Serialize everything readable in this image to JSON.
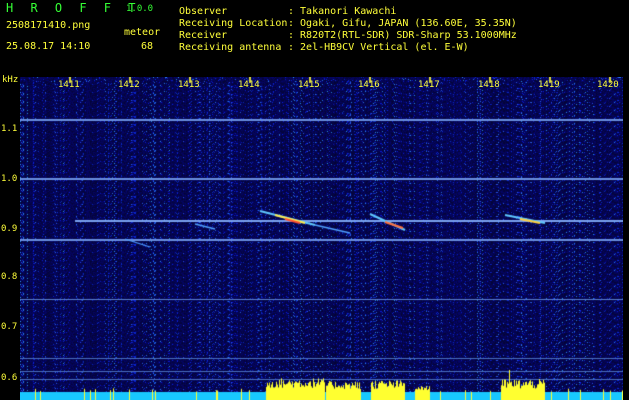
{
  "header": {
    "app_title": "H R O F F T",
    "version": "1.0.0",
    "filename": "2508171410.png",
    "datetime": "25.08.17 14:10",
    "meteor_label": "meteor",
    "meteor_count": "68"
  },
  "info": [
    {
      "key": "Observer",
      "value": ": Takanori Kawachi"
    },
    {
      "key": "Receiving Location",
      "value": ": Ogaki, Gifu, JAPAN (136.60E, 35.35N)"
    },
    {
      "key": "Receiver",
      "value": ": R820T2(RTL-SDR) SDR-Sharp 53.1000MHz"
    },
    {
      "key": "Receiving antenna",
      "value": ": 2el-HB9CV Vertical (el. E-W)"
    }
  ],
  "axis": {
    "y_unit": "kHz",
    "x_ticks": [
      "1411",
      "1412",
      "1413",
      "1414",
      "1415",
      "1416",
      "1417",
      "1418",
      "1419",
      "1420"
    ],
    "y_ticks": [
      "1.1",
      "1.0",
      "0.9",
      "0.8",
      "0.7",
      "0.6"
    ]
  },
  "colors": {
    "background": "#000000",
    "header_green": "#35ff35",
    "header_yellow": "#ffff3a",
    "spectrum_base": "#0a0a68"
  }
}
